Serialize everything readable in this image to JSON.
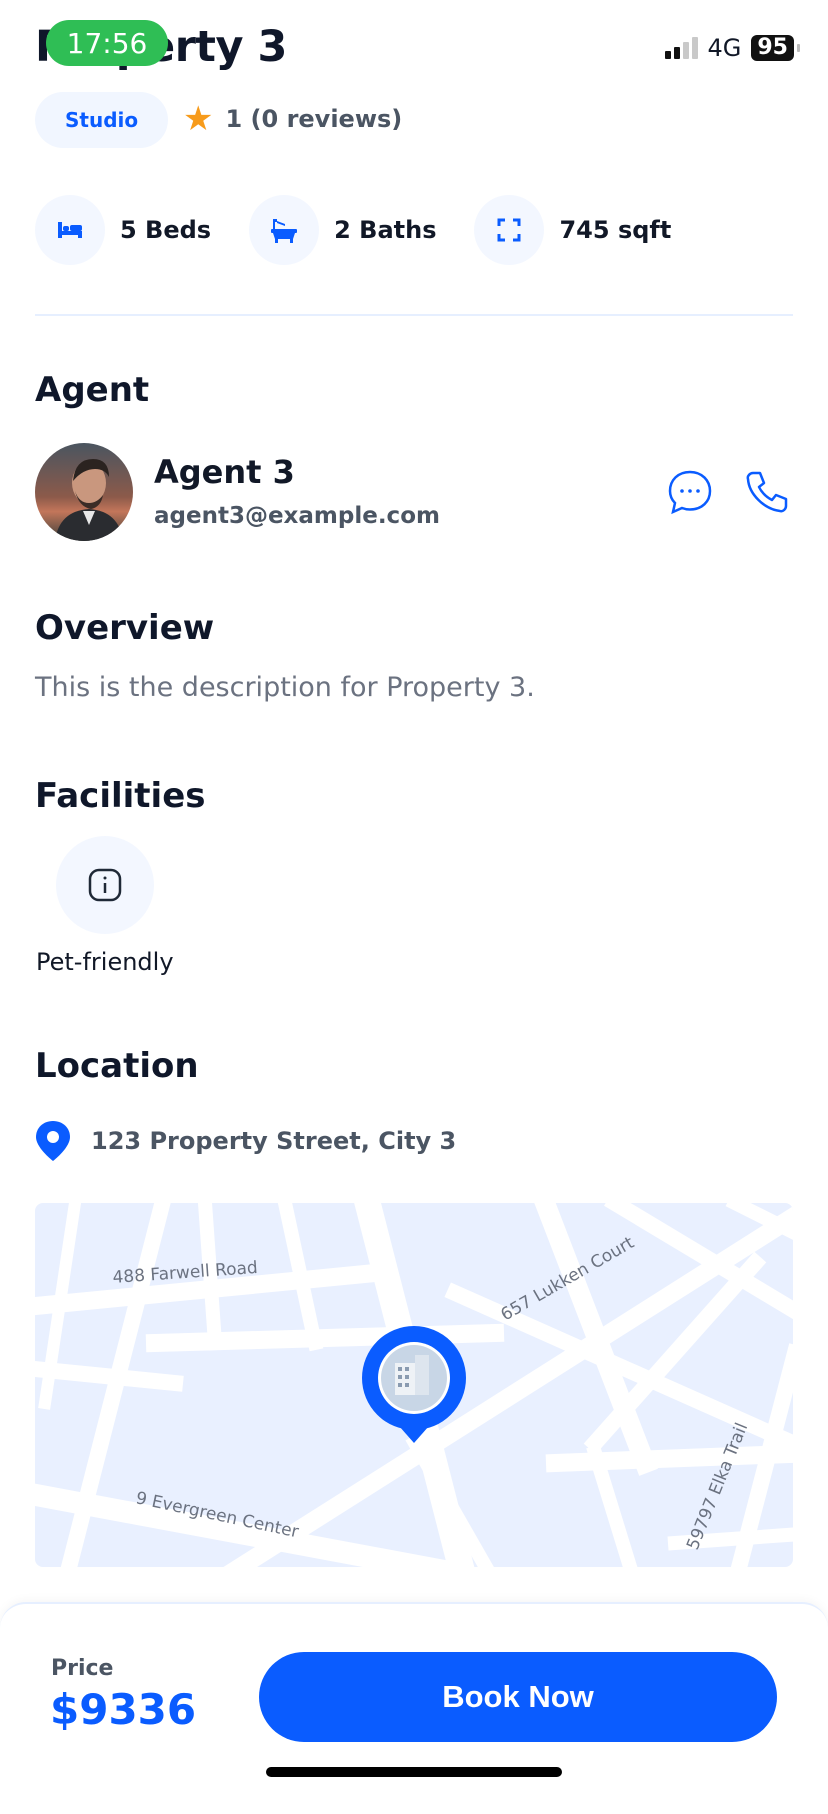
{
  "status_bar": {
    "time": "17:56",
    "network": "4G",
    "battery": "95"
  },
  "header": {
    "title": "Property 3",
    "type_chip": "Studio",
    "rating_text": "1 (0 reviews)"
  },
  "stats": [
    {
      "icon": "bed-icon",
      "label": "5 Beds"
    },
    {
      "icon": "bath-icon",
      "label": "2 Baths"
    },
    {
      "icon": "area-icon",
      "label": "745 sqft"
    }
  ],
  "agent": {
    "section_title": "Agent",
    "name": "Agent 3",
    "email": "agent3@example.com",
    "actions": [
      "chat-icon",
      "phone-icon"
    ]
  },
  "overview": {
    "section_title": "Overview",
    "text": "This is the description for Property 3."
  },
  "facilities": {
    "section_title": "Facilities",
    "items": [
      {
        "icon": "info-icon",
        "label": "Pet-friendly"
      }
    ]
  },
  "location": {
    "section_title": "Location",
    "address": "123 Property Street, City 3",
    "map_labels": [
      "488 Farwell Road",
      "657 Lukken Court",
      "9 Evergreen Center",
      "59797 Elka Trail"
    ]
  },
  "footer": {
    "price_label": "Price",
    "price": "$9336",
    "book_label": "Book Now"
  },
  "colors": {
    "primary": "#0a5cff",
    "time_pill": "#2fbe55",
    "star": "#f79b1b"
  }
}
